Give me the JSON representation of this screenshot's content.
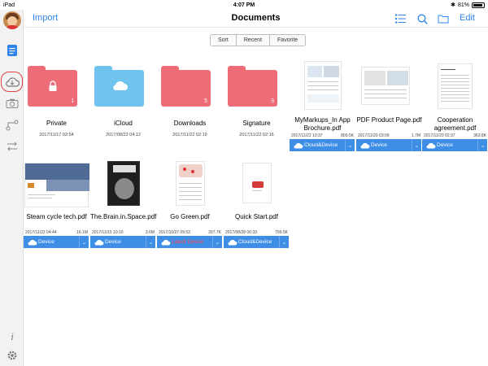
{
  "status_bar": {
    "device": "iPad",
    "time": "4:07 PM",
    "battery": "81%"
  },
  "nav": {
    "import_label": "Import",
    "title": "Documents",
    "edit_label": "Edit"
  },
  "segments": [
    "Sort",
    "Recent",
    "Favorite"
  ],
  "folders": [
    {
      "name": "Private",
      "date": "2017/11/17 02:54",
      "count": "1",
      "color": "#ee6b78",
      "icon": "lock-icon"
    },
    {
      "name": "iCloud",
      "date": "2017/08/23 04:12",
      "count": "",
      "color": "#6fc3ee",
      "icon": "cloud-icon"
    },
    {
      "name": "Downloads",
      "date": "2017/11/22 02:19",
      "count": "5",
      "color": "#ee6b78",
      "icon": ""
    },
    {
      "name": "Signature",
      "date": "2017/11/22 02:16",
      "count": "3",
      "color": "#ee6b78",
      "icon": ""
    }
  ],
  "files": [
    {
      "name": "MyMarkups_In App Brochure.pdf",
      "date": "2017/11/22 10:37",
      "size": "809.5K",
      "sync": "Cloud&Device"
    },
    {
      "name": "PDF Product Page.pdf",
      "date": "2017/11/20 03:09",
      "size": "1.7M",
      "sync": "Device"
    },
    {
      "name": "Cooperation agreement.pdf",
      "date": "2017/11/20 02:37",
      "size": "363.8K",
      "sync": "Device"
    },
    {
      "name": "Steam cycle tech.pdf",
      "date": "2017/11/22 04:44",
      "size": "16.1M",
      "sync": "Device"
    },
    {
      "name": "The.Brain.in.Space.pdf",
      "date": "2017/11/15 10:10",
      "size": "3.6M",
      "sync": "Device"
    },
    {
      "name": "Go Green.pdf",
      "date": "2017/10/27 09:53",
      "size": "397.7K",
      "sync": "Latest Device"
    },
    {
      "name": "Quick Start.pdf",
      "date": "2017/08/28 06:33",
      "size": "799.5K",
      "sync": "Cloud&Device"
    }
  ],
  "colors": {
    "accent": "#2d84ea",
    "sync_bar": "#3f8ee6",
    "warning": "#ff4b4b",
    "highlight_ring": "#e04040"
  },
  "sidebar_icons": [
    "avatar",
    "documents-icon",
    "cloud-sync-icon",
    "camera-icon",
    "connection-icon",
    "transfer-icon",
    "info-icon",
    "settings-gear-icon"
  ]
}
